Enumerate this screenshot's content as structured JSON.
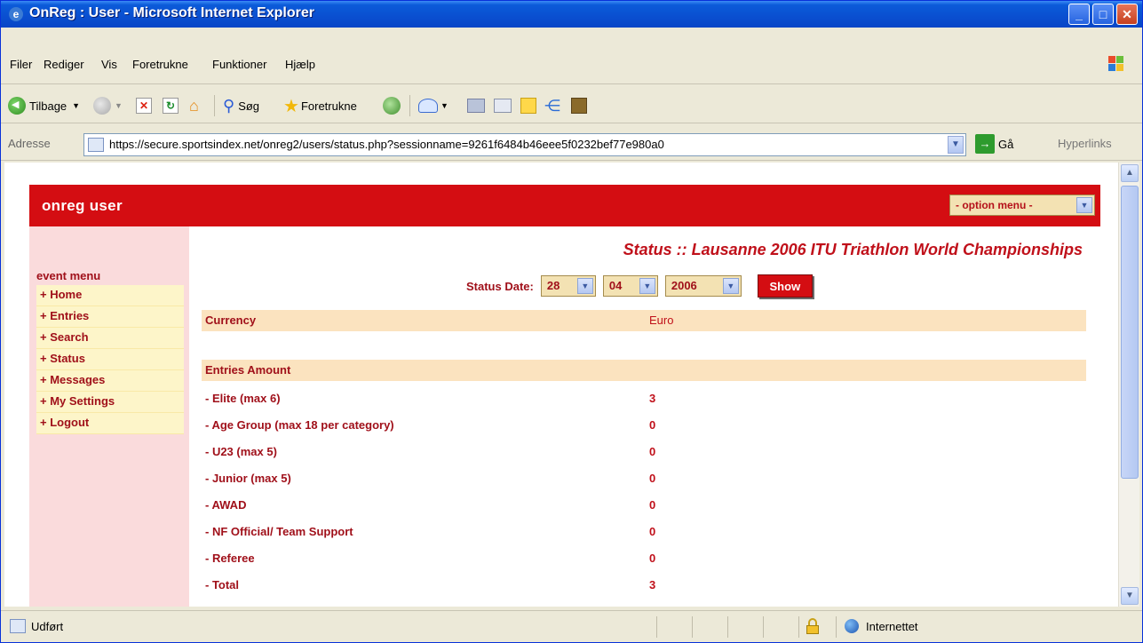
{
  "window": {
    "title": "OnReg : User - Microsoft Internet Explorer"
  },
  "menubar": {
    "items": [
      "Filer",
      "Rediger",
      "Vis",
      "Foretrukne",
      "Funktioner",
      "Hjælp"
    ]
  },
  "toolbar": {
    "back_label": "Tilbage",
    "search_label": "Søg",
    "favorites_label": "Foretrukne"
  },
  "address": {
    "label": "Adresse",
    "url": "https://secure.sportsindex.net/onreg2/users/status.php?sessionname=9261f6484b46eee5f0232bef77e980a0",
    "go_label": "Gå",
    "links_label": "Hyperlinks"
  },
  "page": {
    "brand": "onreg user",
    "option_menu": "- option menu -",
    "event_menu_title": "event menu",
    "event_menu_items": [
      "+ Home",
      "+ Entries",
      "+ Search",
      "+ Status",
      "+ Messages",
      "+ My Settings",
      "+ Logout"
    ],
    "title": "Status :: Lausanne 2006 ITU Triathlon World Championships",
    "status_date_label": "Status Date:",
    "status_day": "28",
    "status_month": "04",
    "status_year": "2006",
    "show_button": "Show",
    "currency_label": "Currency",
    "currency_value": "Euro",
    "entries_amount_label": "Entries Amount",
    "entries": [
      {
        "label": "- Elite (max 6)",
        "value": "3"
      },
      {
        "label": "- Age Group (max 18 per category)",
        "value": "0"
      },
      {
        "label": "- U23 (max 5)",
        "value": "0"
      },
      {
        "label": "- Junior (max 5)",
        "value": "0"
      },
      {
        "label": "- AWAD",
        "value": "0"
      },
      {
        "label": "- NF Official/ Team Support",
        "value": "0"
      },
      {
        "label": "- Referee",
        "value": "0"
      },
      {
        "label": "- Total",
        "value": "3"
      }
    ]
  },
  "statusbar": {
    "status": "Udført",
    "zone": "Internettet"
  },
  "colors": {
    "brand_red": "#d40d12",
    "text_red": "#a0101a",
    "sidebar_pink": "#fadbdc",
    "band_peach": "#fbe3bf"
  }
}
